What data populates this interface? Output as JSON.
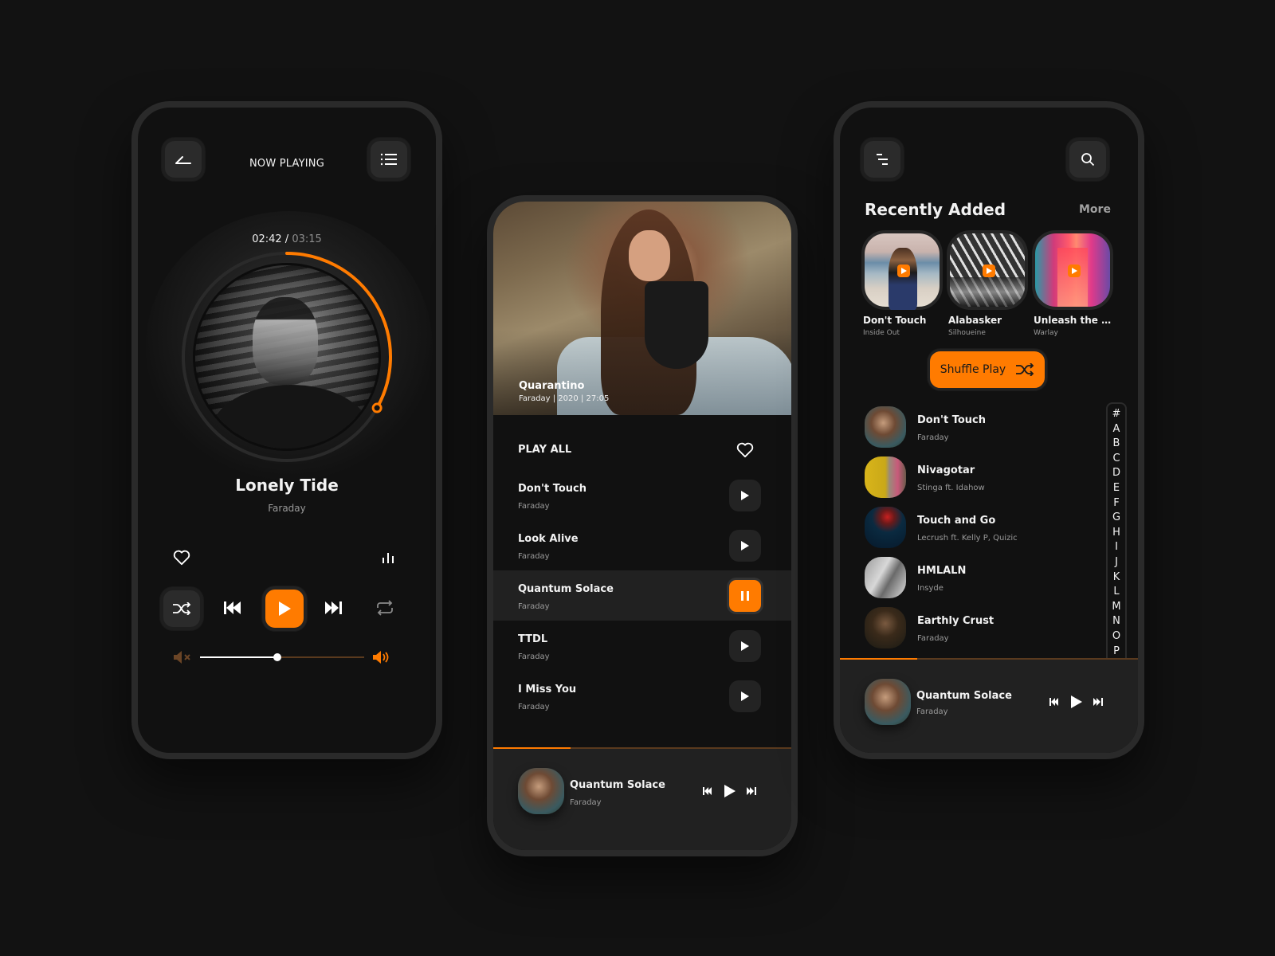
{
  "colors": {
    "accent": "#ff7b00",
    "background": "#121212",
    "panel": "#111111",
    "button": "#2b2b2b",
    "muted_text": "#9a9a9a"
  },
  "now_playing": {
    "title": "NOW PLAYING",
    "back_icon": "back-arrow-icon",
    "menu_icon": "list-icon",
    "time_current": "02:42",
    "time_separator": " / ",
    "time_total": "03:15",
    "progress_fraction": 0.83,
    "song": "Lonely Tide",
    "artist": "Faraday",
    "volume_fraction": 0.47,
    "icons": [
      "heart-icon",
      "equalizer-icon",
      "shuffle-icon",
      "previous-icon",
      "play-icon",
      "next-icon",
      "repeat-icon",
      "mute-icon",
      "volume-up-icon"
    ]
  },
  "album": {
    "title": "Quarantino",
    "meta": "Faraday | 2020 | 27:05",
    "play_all": "PLAY ALL",
    "tracks": [
      {
        "title": "Don't Touch",
        "artist": "Faraday",
        "state": "play"
      },
      {
        "title": "Look Alive",
        "artist": "Faraday",
        "state": "play"
      },
      {
        "title": "Quantum Solace",
        "artist": "Faraday",
        "state": "pause"
      },
      {
        "title": "TTDL",
        "artist": "Faraday",
        "state": "play"
      },
      {
        "title": "I Miss You",
        "artist": "Faraday",
        "state": "play"
      }
    ],
    "mini_player": {
      "title": "Quantum Solace",
      "artist": "Faraday",
      "progress_fraction": 0.26
    }
  },
  "library": {
    "menu_icon": "menu-icon",
    "search_icon": "search-icon",
    "recently_added_title": "Recently Added",
    "more_label": "More",
    "recent": [
      {
        "title": "Don't Touch",
        "artist": "Inside Out"
      },
      {
        "title": "Alabasker",
        "artist": "Silhoueine"
      },
      {
        "title": "Unleash the st...",
        "artist": "Warlay"
      }
    ],
    "shuffle_label": "Shuffle Play",
    "songs": [
      {
        "title": "Don't Touch",
        "artist": "Faraday"
      },
      {
        "title": "Nivagotar",
        "artist": "Stinga ft. Idahow"
      },
      {
        "title": "Touch and Go",
        "artist": "Lecrush ft. Kelly P, Quizic"
      },
      {
        "title": "HMLALN",
        "artist": "Insyde"
      },
      {
        "title": "Earthly Crust",
        "artist": "Faraday"
      }
    ],
    "alphabet": [
      "#",
      "A",
      "B",
      "C",
      "D",
      "E",
      "F",
      "G",
      "H",
      "I",
      "J",
      "K",
      "L",
      "M",
      "N",
      "O",
      "P"
    ],
    "mini_player": {
      "title": "Quantum Solace",
      "artist": "Faraday",
      "progress_fraction": 0.26
    }
  }
}
